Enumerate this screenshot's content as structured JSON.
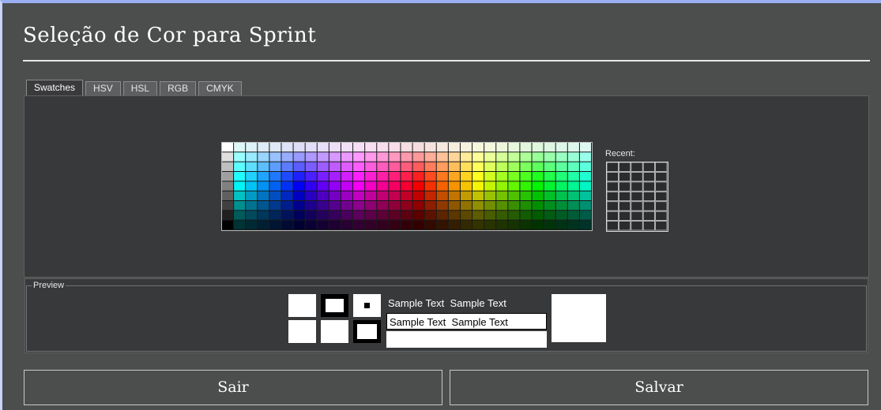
{
  "window": {
    "title": "Seleção de Cor para Sprint"
  },
  "tabs": [
    {
      "label": "Swatches",
      "active": true
    },
    {
      "label": "HSV",
      "active": false
    },
    {
      "label": "HSL",
      "active": false
    },
    {
      "label": "RGB",
      "active": false
    },
    {
      "label": "CMYK",
      "active": false
    }
  ],
  "swatches": {
    "recent_label": "Recent:"
  },
  "preview": {
    "legend": "Preview",
    "sample_text_1": "Sample Text",
    "sample_text_2": "Sample Text",
    "sample_text_3": "Sample Text",
    "sample_text_4": "Sample Text"
  },
  "buttons": {
    "exit_label": "Sair",
    "save_label": "Salvar"
  },
  "colors": {
    "window_bg": "#4c4d4d",
    "panel_bg": "#38393b",
    "border_accent": "#9ab0f2",
    "preview_color": "#ffffff",
    "text": "#ffffff"
  }
}
